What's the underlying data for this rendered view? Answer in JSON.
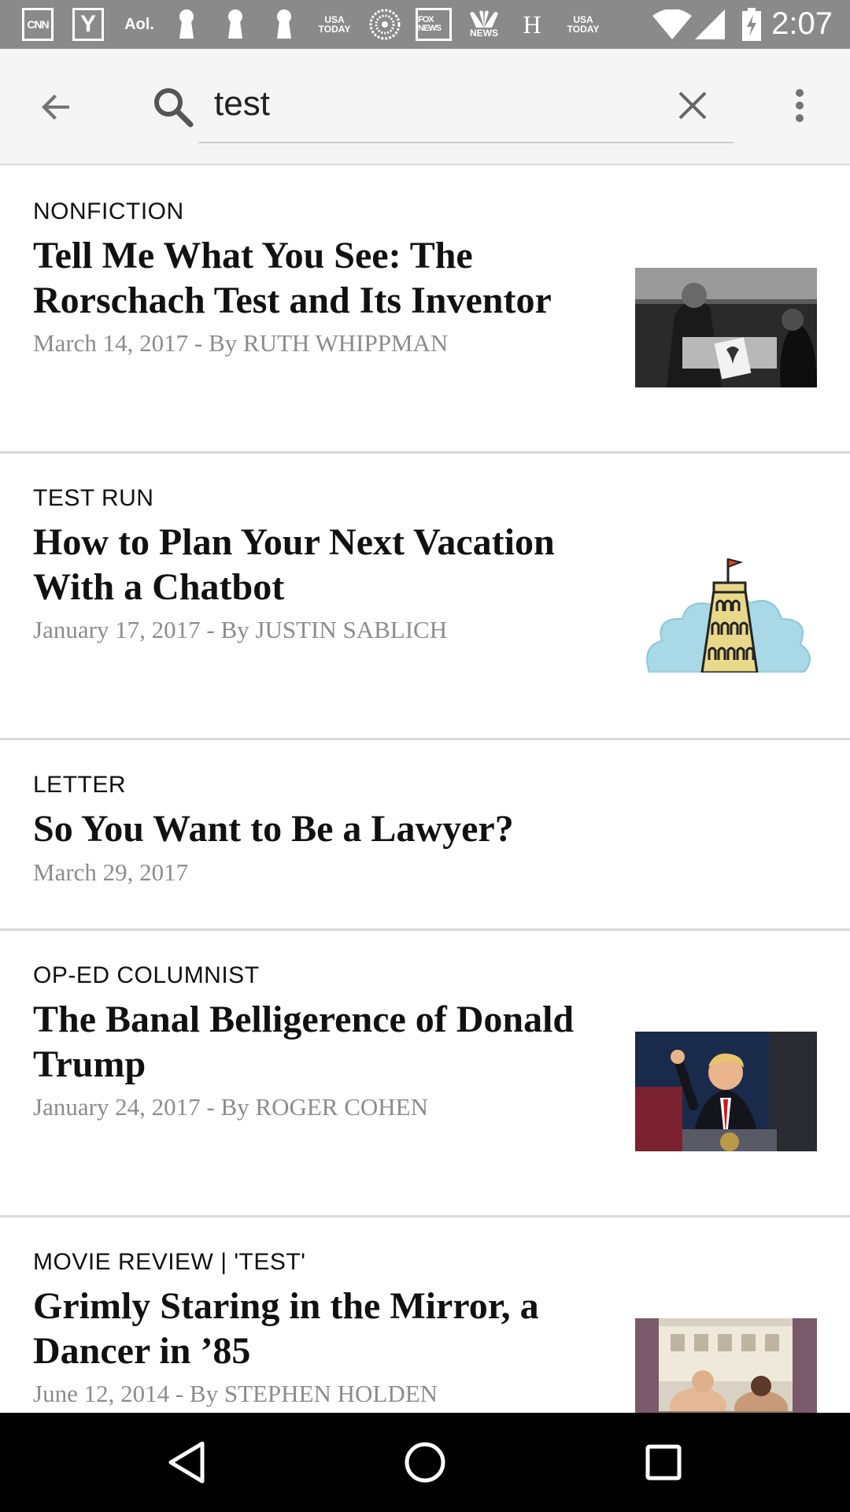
{
  "status_bar": {
    "notification_icons": [
      {
        "name": "cnn-icon",
        "text": "CNN"
      },
      {
        "name": "yahoo-icon",
        "text": "Y"
      },
      {
        "name": "aol-icon",
        "text": "Aol."
      },
      {
        "name": "keyhole-icon-1",
        "text": ""
      },
      {
        "name": "keyhole-icon-2",
        "text": ""
      },
      {
        "name": "keyhole-icon-3",
        "text": ""
      },
      {
        "name": "usa-today-icon-1",
        "text": "USA TODAY"
      },
      {
        "name": "ring-icon",
        "text": ""
      },
      {
        "name": "fox-news-icon",
        "text": "FOX NEWS"
      },
      {
        "name": "nbc-news-icon",
        "text": "NEWS"
      },
      {
        "name": "huffpost-icon",
        "text": "H"
      },
      {
        "name": "usa-today-icon-2",
        "text": "USA TODAY"
      }
    ],
    "time": "2:07"
  },
  "search": {
    "query": "test"
  },
  "results": [
    {
      "kicker": "NONFICTION",
      "headline": "Tell Me What You See: The Rorschach Test and Its Inventor",
      "byline": "March 14, 2017 - By RUTH WHIPPMAN",
      "thumbnail": "rorschach-photo"
    },
    {
      "kicker": "TEST RUN",
      "headline": "How to Plan Your Next Vacation With a Chatbot",
      "byline": "January 17, 2017 - By JUSTIN SABLICH",
      "thumbnail": "tower-illustration"
    },
    {
      "kicker": "LETTER",
      "headline": "So You Want to Be a Lawyer?",
      "byline": "March 29, 2017",
      "thumbnail": ""
    },
    {
      "kicker": "OP-ED COLUMNIST",
      "headline": "The Banal Belligerence of Donald Trump",
      "byline": "January 24, 2017 - By ROGER COHEN",
      "thumbnail": "speech-photo"
    },
    {
      "kicker": "MOVIE REVIEW | 'TEST'",
      "headline": "Grimly Staring in the Mirror, a Dancer in ’85",
      "byline": "June 12, 2014 - By STEPHEN HOLDEN",
      "thumbnail": "dancers-photo"
    }
  ],
  "colors": {
    "status_bar": "#8a8a8a",
    "app_bar": "#f5f5f5",
    "kicker": "#111111",
    "byline": "#8c8c8c",
    "divider": "#d8d8d8",
    "nav_bar": "#000000"
  }
}
